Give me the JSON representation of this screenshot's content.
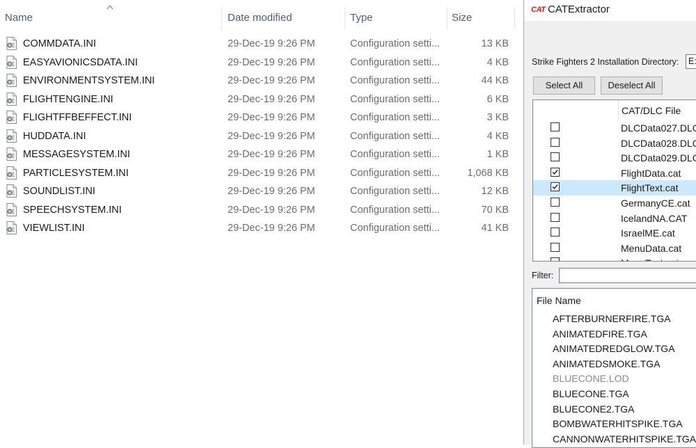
{
  "explorer": {
    "columns": {
      "name": "Name",
      "date": "Date modified",
      "type": "Type",
      "size": "Size"
    },
    "files": [
      {
        "name": "COMMDATA.INI",
        "date": "29-Dec-19 9:26 PM",
        "type": "Configuration setti...",
        "size": "13 KB"
      },
      {
        "name": "EASYAVIONICSDATA.INI",
        "date": "29-Dec-19 9:26 PM",
        "type": "Configuration setti...",
        "size": "4 KB"
      },
      {
        "name": "ENVIRONMENTSYSTEM.INI",
        "date": "29-Dec-19 9:26 PM",
        "type": "Configuration setti...",
        "size": "44 KB"
      },
      {
        "name": "FLIGHTENGINE.INI",
        "date": "29-Dec-19 9:26 PM",
        "type": "Configuration setti...",
        "size": "6 KB"
      },
      {
        "name": "FLIGHTFFBEFFECT.INI",
        "date": "29-Dec-19 9:26 PM",
        "type": "Configuration setti...",
        "size": "3 KB"
      },
      {
        "name": "HUDDATA.INI",
        "date": "29-Dec-19 9:26 PM",
        "type": "Configuration setti...",
        "size": "4 KB"
      },
      {
        "name": "MESSAGESYSTEM.INI",
        "date": "29-Dec-19 9:26 PM",
        "type": "Configuration setti...",
        "size": "1 KB"
      },
      {
        "name": "PARTICLESYSTEM.INI",
        "date": "29-Dec-19 9:26 PM",
        "type": "Configuration setti...",
        "size": "1,068 KB"
      },
      {
        "name": "SOUNDLIST.INI",
        "date": "29-Dec-19 9:26 PM",
        "type": "Configuration setti...",
        "size": "12 KB"
      },
      {
        "name": "SPEECHSYSTEM.INI",
        "date": "29-Dec-19 9:26 PM",
        "type": "Configuration setti...",
        "size": "70 KB"
      },
      {
        "name": "VIEWLIST.INI",
        "date": "29-Dec-19 9:26 PM",
        "type": "Configuration setti...",
        "size": "41 KB"
      }
    ]
  },
  "catextractor": {
    "logo_text": "CAT",
    "title": "CATExtractor",
    "install_dir_label": "Strike Fighters 2 Installation Directory:",
    "install_dir_value": "E:",
    "select_all_label": "Select All",
    "deselect_all_label": "Deselect All",
    "cat_header": "CAT/DLC File",
    "cat_files": [
      {
        "label": "DLCData027.DLC",
        "checked": false,
        "selected": false
      },
      {
        "label": "DLCData028.DLC",
        "checked": false,
        "selected": false
      },
      {
        "label": "DLCData029.DLC",
        "checked": false,
        "selected": false
      },
      {
        "label": "FlightData.cat",
        "checked": true,
        "selected": false
      },
      {
        "label": "FlightText.cat",
        "checked": true,
        "selected": true
      },
      {
        "label": "GermanyCE.cat",
        "checked": false,
        "selected": false
      },
      {
        "label": "IcelandNA.CAT",
        "checked": false,
        "selected": false
      },
      {
        "label": "IsraelME.cat",
        "checked": false,
        "selected": false
      },
      {
        "label": "MenuData.cat",
        "checked": false,
        "selected": false
      },
      {
        "label": "MenuText.cat",
        "checked": false,
        "selected": false
      }
    ],
    "filter_label": "Filter:",
    "filter_value": "",
    "file_list_header": "File Name",
    "file_list": [
      {
        "name": "AFTERBURNERFIRE.TGA",
        "dim": false
      },
      {
        "name": "ANIMATEDFIRE.TGA",
        "dim": false
      },
      {
        "name": "ANIMATEDREDGLOW.TGA",
        "dim": false
      },
      {
        "name": "ANIMATEDSMOKE.TGA",
        "dim": false
      },
      {
        "name": "BLUECONE.LOD",
        "dim": true
      },
      {
        "name": "BLUECONE.TGA",
        "dim": false
      },
      {
        "name": "BLUECONE2.TGA",
        "dim": false
      },
      {
        "name": "BOMBWATERHITSPIKE.TGA",
        "dim": false
      },
      {
        "name": "CANNONWATERHITSPIKE.TGA",
        "dim": false
      }
    ]
  }
}
